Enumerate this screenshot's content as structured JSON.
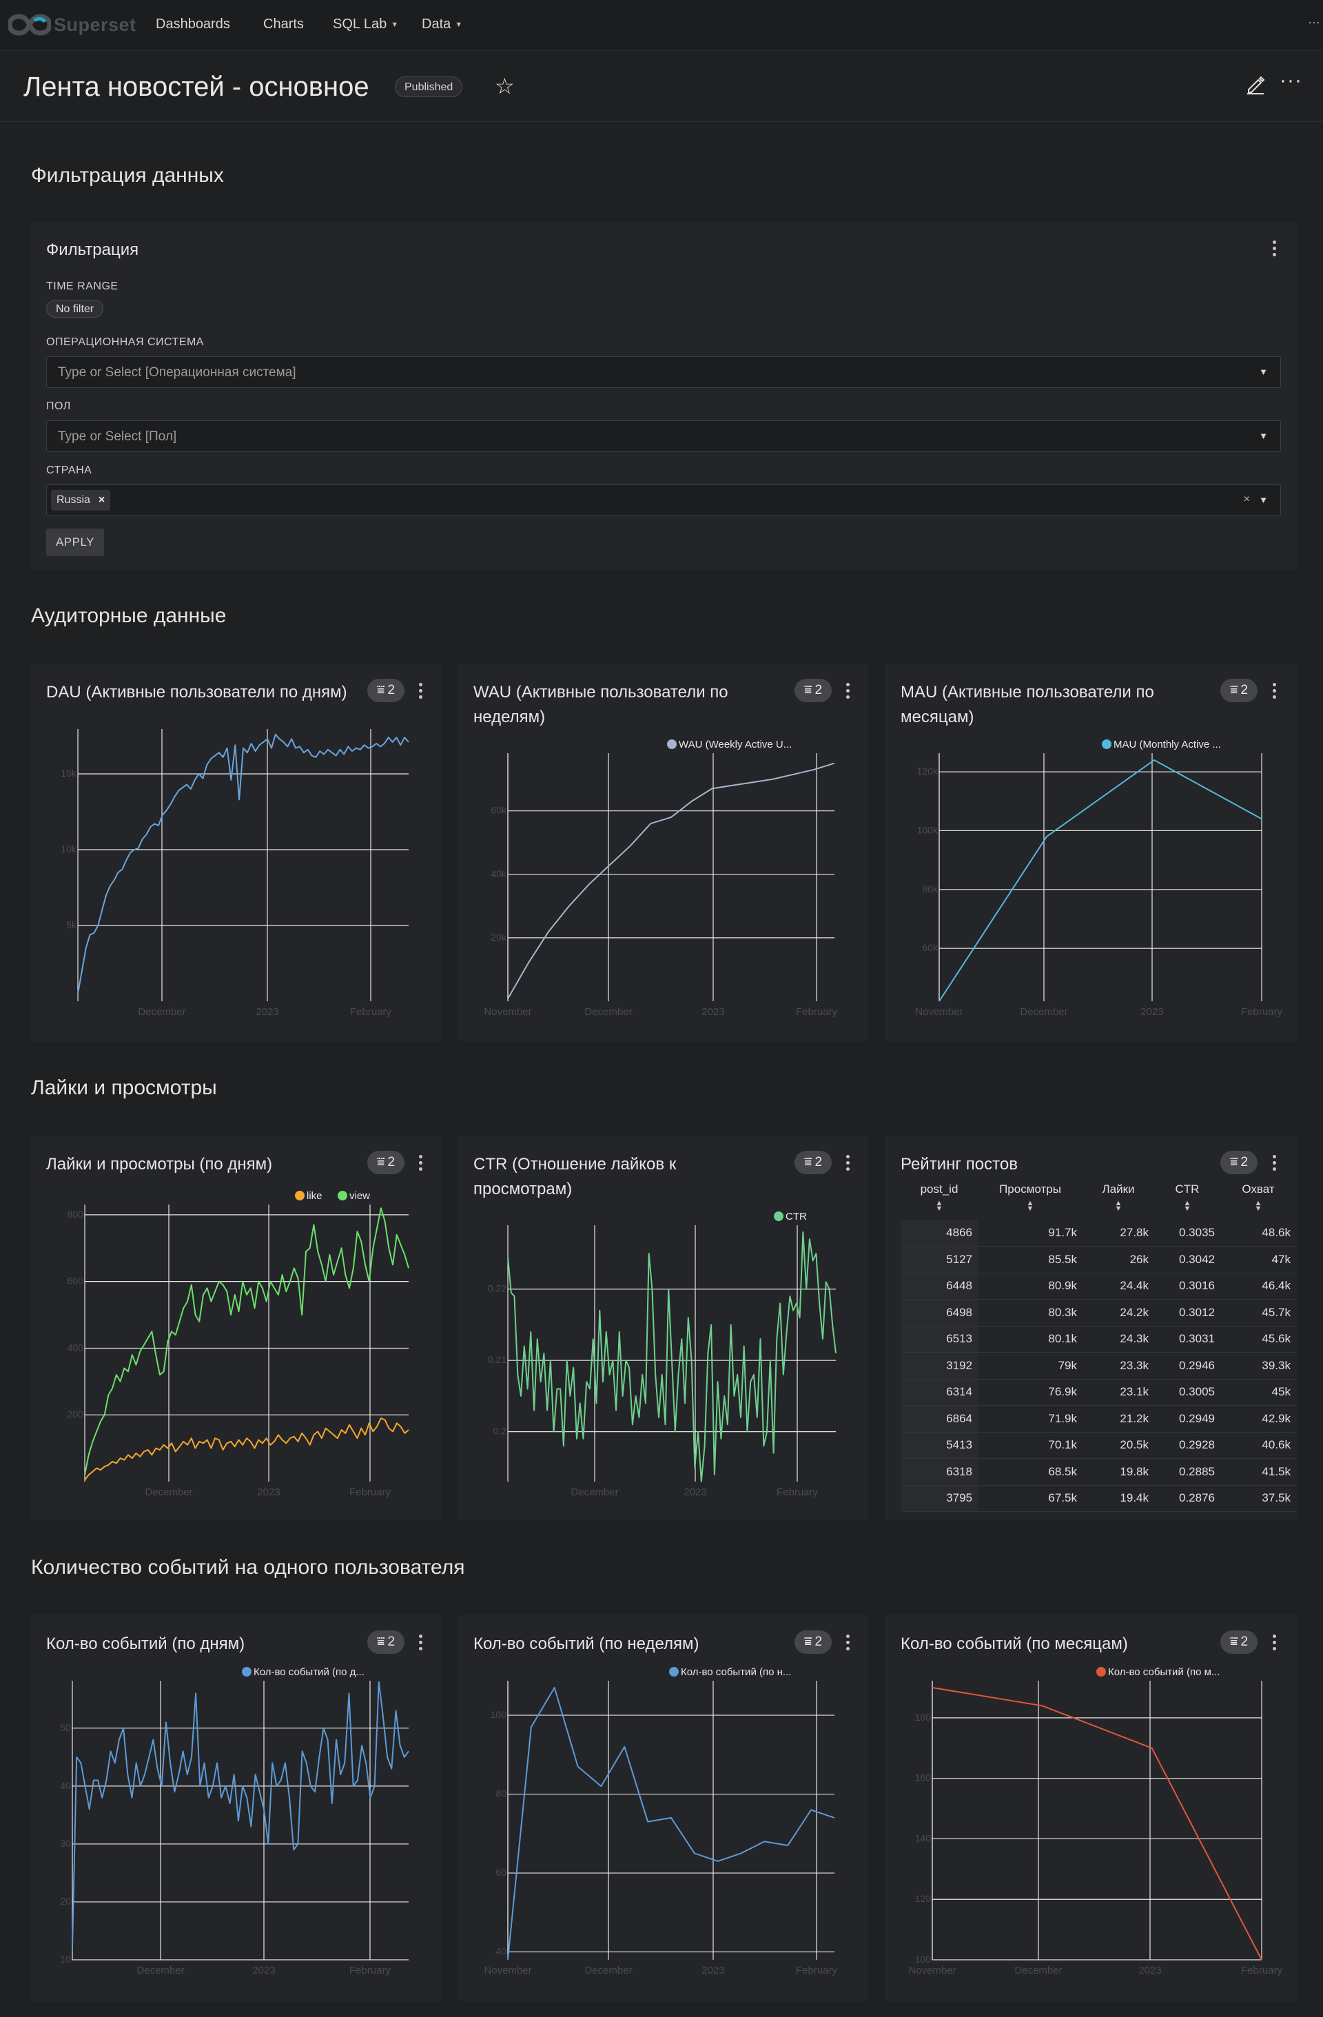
{
  "nav": {
    "logo_text": "Superset",
    "items": [
      {
        "label": "Dashboards",
        "dropdown": false
      },
      {
        "label": "Charts",
        "dropdown": false
      },
      {
        "label": "SQL Lab",
        "dropdown": true
      },
      {
        "label": "Data",
        "dropdown": true
      }
    ]
  },
  "header": {
    "title": "Лента новостей - основное",
    "status_badge": "Published"
  },
  "sections": {
    "filter": "Фильтрация данных",
    "audience": "Аудиторные данные",
    "likes": "Лайки и просмотры",
    "events": "Количество событий на одного пользователя"
  },
  "filters": {
    "panel_title": "Фильтрация",
    "time_range": {
      "label": "TIME RANGE",
      "value": "No filter"
    },
    "os": {
      "label": "ОПЕРАЦИОННАЯ СИСТЕМА",
      "placeholder": "Type or Select [Операционная система]"
    },
    "gender": {
      "label": "ПОЛ",
      "placeholder": "Type or Select [Пол]"
    },
    "country": {
      "label": "СТРАНА",
      "selected": "Russia"
    },
    "apply_label": "APPLY"
  },
  "filter_count": "2",
  "colors": {
    "background": "#1f2022",
    "card": "#242528",
    "dau_line": "#6aa5db",
    "wau_line": "#a9b4cc",
    "mau_line": "#53b9d8",
    "like_line": "#f5a62d",
    "view_line": "#6cde6c",
    "ctr_line": "#6ecf8e",
    "events_blue": "#5c9ad8",
    "events_red": "#e0573c"
  },
  "chart_data": [
    {
      "id": "dau",
      "type": "line",
      "title": "DAU (Активные пользователи по дням)",
      "x_ticks": [
        "December",
        "2023",
        "February"
      ],
      "y_ticks": [
        "5k",
        "10k",
        "15k"
      ],
      "ylim": [
        0,
        17500
      ],
      "series": [
        {
          "values": [
            500,
            2000,
            3500,
            4400,
            4500,
            5000,
            6000,
            7000,
            7600,
            8000,
            8500,
            8700,
            9300,
            9800,
            10000,
            10100,
            10700,
            11000,
            11500,
            11700,
            11600,
            12300,
            12600,
            13000,
            13500,
            13900,
            14100,
            14300,
            14000,
            14600,
            15000,
            14700,
            15600,
            16000,
            16200,
            16400,
            16100,
            16700,
            14600,
            16900,
            13300,
            16700,
            16400,
            17000,
            16500,
            16900,
            17100,
            17300,
            16700,
            17600,
            17300,
            17100,
            16800,
            17300,
            16700,
            16800,
            16400,
            16600,
            16200,
            16100,
            16500,
            16300,
            16600,
            16400,
            16200,
            16600,
            16300,
            16800,
            16500,
            16700,
            16600,
            16900,
            16700,
            16800,
            17000,
            16800,
            17000,
            17400,
            17100,
            17400,
            16900,
            17400,
            17100
          ]
        }
      ]
    },
    {
      "id": "wau",
      "type": "line",
      "title": "WAU (Активные пользователи по неделям)",
      "x_ticks": [
        "November",
        "December",
        "2023",
        "February"
      ],
      "y_ticks": [
        "20k",
        "40k",
        "60k"
      ],
      "ylim": [
        0,
        76000
      ],
      "series": [
        {
          "name": "WAU (Weekly Active U...",
          "values": [
            800,
            12000,
            22000,
            30000,
            37000,
            43000,
            49000,
            56000,
            58000,
            63000,
            67000,
            68000,
            69000,
            70000,
            71500,
            73000,
            75000
          ]
        }
      ]
    },
    {
      "id": "mau",
      "type": "line",
      "title": "MAU (Активные пользователи по месяцам)",
      "x_ticks": [
        "November",
        "December",
        "2023",
        "February"
      ],
      "y_ticks": [
        "60k",
        "80k",
        "100k",
        "120k"
      ],
      "ylim": [
        42000,
        124000
      ],
      "series": [
        {
          "name": "MAU (Monthly Active ...",
          "values": [
            42000,
            98000,
            124000,
            104000
          ]
        }
      ]
    },
    {
      "id": "likes_views",
      "type": "line",
      "title": "Лайки и просмотры (по дням)",
      "x_ticks": [
        "December",
        "2023",
        "February"
      ],
      "y_ticks": [
        "200",
        "400",
        "600",
        "800"
      ],
      "ylim": [
        0,
        810
      ],
      "series": [
        {
          "name": "like",
          "values": [
            5,
            20,
            30,
            40,
            35,
            45,
            50,
            60,
            55,
            70,
            65,
            80,
            70,
            85,
            75,
            90,
            95,
            80,
            100,
            95,
            110,
            100,
            115,
            90,
            105,
            120,
            110,
            130,
            100,
            120,
            115,
            125,
            100,
            130,
            125,
            95,
            115,
            120,
            105,
            125,
            110,
            130,
            120,
            100,
            125,
            115,
            130,
            110,
            120,
            140,
            125,
            115,
            130,
            135,
            120,
            145,
            130,
            110,
            140,
            150,
            130,
            160,
            150,
            140,
            130,
            155,
            145,
            170,
            150,
            130,
            160,
            140,
            175,
            150,
            165,
            190,
            185,
            160,
            150,
            175,
            165,
            145,
            155
          ]
        },
        {
          "name": "view",
          "values": [
            20,
            80,
            120,
            150,
            180,
            200,
            260,
            280,
            320,
            300,
            340,
            330,
            380,
            350,
            390,
            410,
            430,
            450,
            380,
            320,
            330,
            420,
            450,
            440,
            480,
            520,
            540,
            590,
            500,
            480,
            560,
            580,
            540,
            570,
            600,
            590,
            570,
            500,
            560,
            510,
            600,
            560,
            580,
            520,
            600,
            580,
            540,
            600,
            580,
            560,
            620,
            570,
            600,
            640,
            610,
            500,
            690,
            700,
            770,
            690,
            650,
            600,
            680,
            620,
            660,
            700,
            620,
            580,
            640,
            750,
            720,
            650,
            600,
            700,
            760,
            820,
            780,
            700,
            650,
            740,
            710,
            680,
            640
          ]
        }
      ]
    },
    {
      "id": "ctr",
      "type": "line",
      "title": "CTR (Отношение лайков к просмотрам)",
      "x_ticks": [
        "December",
        "2023",
        "February"
      ],
      "y_ticks": [
        "0.2",
        "0.21",
        "0.22"
      ],
      "ylim": [
        0.193,
        0.228
      ],
      "series": [
        {
          "name": "CTR",
          "values": [
            0.2245,
            0.2195,
            0.219,
            0.208,
            0.205,
            0.212,
            0.206,
            0.214,
            0.203,
            0.213,
            0.207,
            0.211,
            0.203,
            0.21,
            0.2,
            0.206,
            0.206,
            0.198,
            0.21,
            0.205,
            0.209,
            0.199,
            0.204,
            0.199,
            0.207,
            0.206,
            0.213,
            0.204,
            0.217,
            0.207,
            0.214,
            0.208,
            0.21,
            0.203,
            0.214,
            0.205,
            0.21,
            0.209,
            0.201,
            0.205,
            0.202,
            0.208,
            0.204,
            0.225,
            0.22,
            0.208,
            0.202,
            0.208,
            0.201,
            0.22,
            0.21,
            0.2,
            0.208,
            0.213,
            0.204,
            0.216,
            0.21,
            0.195,
            0.2,
            0.193,
            0.198,
            0.211,
            0.215,
            0.194,
            0.207,
            0.199,
            0.205,
            0.201,
            0.215,
            0.205,
            0.208,
            0.202,
            0.212,
            0.2,
            0.207,
            0.208,
            0.202,
            0.213,
            0.198,
            0.2,
            0.21,
            0.197,
            0.213,
            0.218,
            0.208,
            0.214,
            0.219,
            0.217,
            0.218,
            0.216,
            0.228,
            0.22,
            0.227,
            0.224,
            0.225,
            0.218,
            0.213,
            0.221,
            0.22,
            0.215,
            0.211
          ]
        }
      ]
    },
    {
      "id": "events_day",
      "type": "line",
      "title": "Кол-во событий (по дням)",
      "x_ticks": [
        "December",
        "2023",
        "February"
      ],
      "y_ticks": [
        "10",
        "20",
        "30",
        "40",
        "50"
      ],
      "ylim": [
        10,
        57
      ],
      "series": [
        {
          "name": "Кол-во событий (по д...",
          "values": [
            12,
            45,
            44,
            40,
            36,
            41,
            41,
            38,
            41,
            46,
            44,
            48,
            50,
            42,
            38,
            44,
            40,
            42,
            45,
            48,
            43,
            40,
            51,
            44,
            39,
            42,
            46,
            42,
            45,
            56,
            40,
            44,
            38,
            40,
            44,
            38,
            40,
            37,
            42,
            34,
            40,
            38,
            33,
            42,
            39,
            36,
            30,
            44,
            40,
            41,
            44,
            38,
            29,
            30,
            46,
            44,
            40,
            39,
            45,
            50,
            48,
            37,
            48,
            42,
            44,
            56,
            40,
            41,
            47,
            44,
            38,
            40,
            58,
            52,
            45,
            43,
            53,
            47,
            45,
            46
          ]
        }
      ]
    },
    {
      "id": "events_week",
      "type": "line",
      "title": "Кол-во событий (по неделям)",
      "x_ticks": [
        "November",
        "December",
        "2023",
        "February"
      ],
      "y_ticks": [
        "40",
        "60",
        "80",
        "100"
      ],
      "ylim": [
        38,
        107
      ],
      "series": [
        {
          "name": "Кол-во событий (по н...",
          "values": [
            38,
            97,
            107,
            87,
            82,
            92,
            73,
            74,
            65,
            63,
            65,
            68,
            67,
            76,
            74
          ]
        }
      ]
    },
    {
      "id": "events_month",
      "type": "line",
      "title": "Кол-во событий (по месяцам)",
      "x_ticks": [
        "November",
        "December",
        "2023",
        "February"
      ],
      "y_ticks": [
        "100",
        "120",
        "140",
        "160",
        "180"
      ],
      "ylim": [
        100,
        190
      ],
      "series": [
        {
          "name": "Кол-во событий (по м...",
          "values": [
            190,
            184,
            170,
            100
          ]
        }
      ]
    },
    {
      "id": "posts_rating",
      "type": "table",
      "title": "Рейтинг постов",
      "columns": [
        "post_id",
        "Просмотры",
        "Лайки",
        "CTR",
        "Охват"
      ],
      "rows": [
        [
          "4866",
          "91.7k",
          "27.8k",
          "0.3035",
          "48.6k"
        ],
        [
          "5127",
          "85.5k",
          "26k",
          "0.3042",
          "47k"
        ],
        [
          "6448",
          "80.9k",
          "24.4k",
          "0.3016",
          "46.4k"
        ],
        [
          "6498",
          "80.3k",
          "24.2k",
          "0.3012",
          "45.7k"
        ],
        [
          "6513",
          "80.1k",
          "24.3k",
          "0.3031",
          "45.6k"
        ],
        [
          "3192",
          "79k",
          "23.3k",
          "0.2946",
          "39.3k"
        ],
        [
          "6314",
          "76.9k",
          "23.1k",
          "0.3005",
          "45k"
        ],
        [
          "6864",
          "71.9k",
          "21.2k",
          "0.2949",
          "42.9k"
        ],
        [
          "5413",
          "70.1k",
          "20.5k",
          "0.2928",
          "40.6k"
        ],
        [
          "6318",
          "68.5k",
          "19.8k",
          "0.2885",
          "41.5k"
        ],
        [
          "3795",
          "67.5k",
          "19.4k",
          "0.2876",
          "37.5k"
        ]
      ]
    }
  ]
}
